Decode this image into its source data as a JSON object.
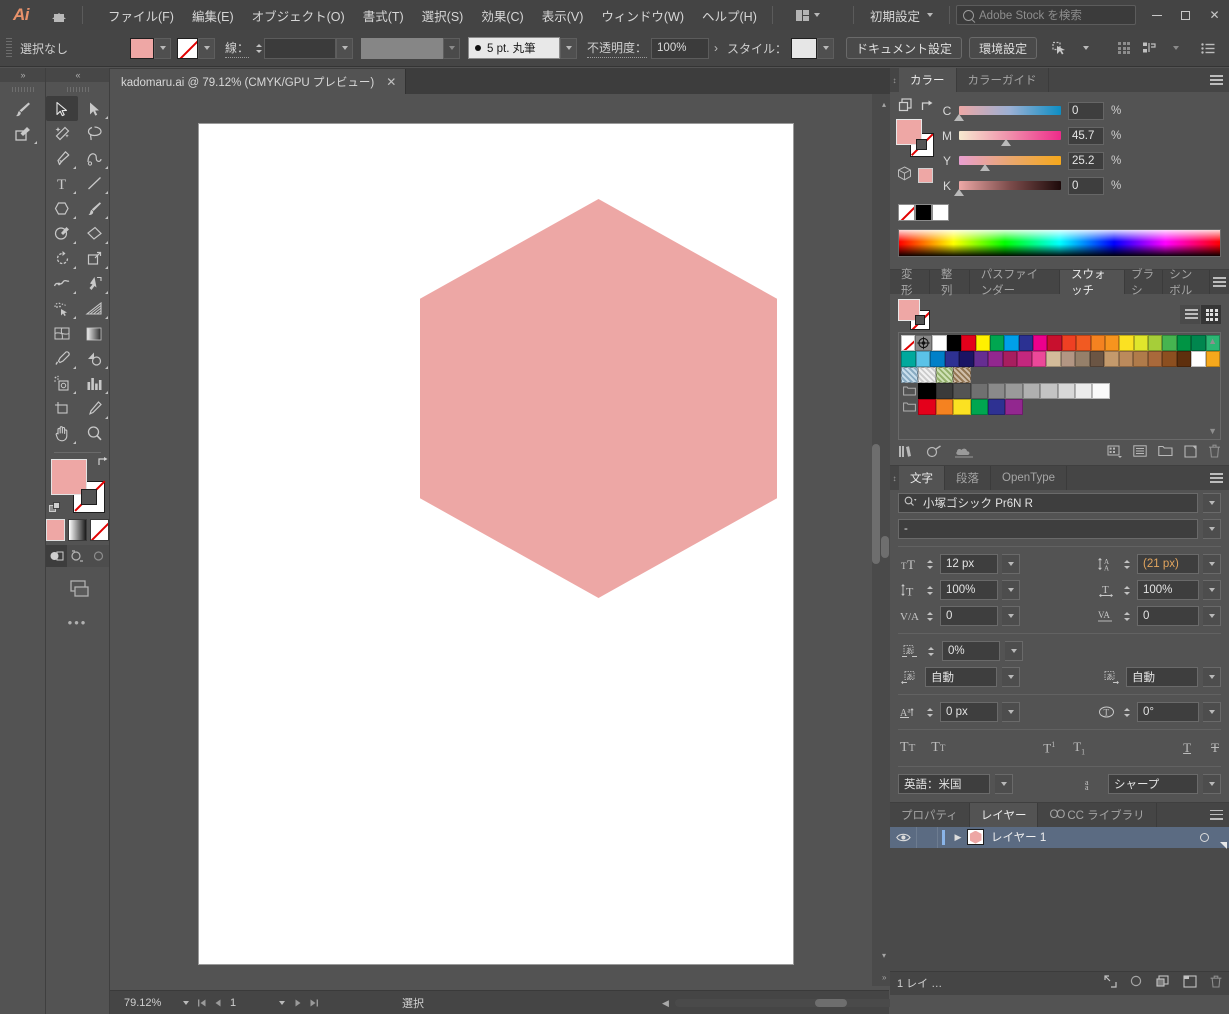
{
  "app": {
    "logo": "Ai",
    "home_icon": "home-icon"
  },
  "menubar": {
    "items": [
      {
        "label": "ファイル(F)"
      },
      {
        "label": "編集(E)"
      },
      {
        "label": "オブジェクト(O)"
      },
      {
        "label": "書式(T)"
      },
      {
        "label": "選択(S)"
      },
      {
        "label": "効果(C)"
      },
      {
        "label": "表示(V)"
      },
      {
        "label": "ウィンドウ(W)"
      },
      {
        "label": "ヘルプ(H)"
      }
    ],
    "arrange_icon": "arrange-documents-icon",
    "workspace": "初期設定",
    "search_placeholder": "Adobe Stock を検索",
    "window_controls": {
      "minimize": "minimize-icon",
      "maximize": "maximize-icon",
      "close": "✕"
    }
  },
  "controlbar": {
    "selection_status": "選択なし",
    "fill_color": "#eea7a5",
    "stroke_color": "none",
    "stroke_label": "線：",
    "stroke_weight": "",
    "stroke_profile": "",
    "brush_definition": "5 pt. 丸筆",
    "opacity_label": "不透明度：",
    "opacity_value": "100%",
    "style_label": "スタイル：",
    "document_setup": "ドキュメント設定",
    "preferences": "環境設定",
    "select_similar_icon": "select-similar-icon",
    "align_icon": "align-icon",
    "distribute_icon": "distribute-icon",
    "more_options_icon": "panel-options-icon"
  },
  "tabbar": {
    "document_tab": "kadomaru.ai @ 79.12% (CMYK/GPU プレビュー)",
    "close_icon": "✕"
  },
  "toolbar": {
    "left_column": [
      "paintbrush-tool-icon",
      "shaper-tool-icon"
    ],
    "tools": [
      {
        "name": "selection-tool",
        "selected": true
      },
      {
        "name": "direct-selection-tool",
        "selected": false
      },
      {
        "name": "magic-wand-tool",
        "selected": false
      },
      {
        "name": "lasso-tool",
        "selected": false
      },
      {
        "name": "pen-tool",
        "selected": false
      },
      {
        "name": "curvature-tool",
        "selected": false
      },
      {
        "name": "type-tool",
        "selected": false
      },
      {
        "name": "line-segment-tool",
        "selected": false
      },
      {
        "name": "polygon-shape-tool",
        "selected": false
      },
      {
        "name": "paintbrush-tool",
        "selected": false
      },
      {
        "name": "shaper-tool",
        "selected": false
      },
      {
        "name": "eraser-tool",
        "selected": false
      },
      {
        "name": "rotate-tool",
        "selected": false
      },
      {
        "name": "scale-tool",
        "selected": false
      },
      {
        "name": "width-tool",
        "selected": false
      },
      {
        "name": "free-transform-tool",
        "selected": false
      },
      {
        "name": "shape-builder-tool",
        "selected": false
      },
      {
        "name": "perspective-grid-tool",
        "selected": false
      },
      {
        "name": "mesh-tool",
        "selected": false
      },
      {
        "name": "gradient-tool",
        "selected": false
      },
      {
        "name": "eyedropper-tool",
        "selected": false
      },
      {
        "name": "blend-tool",
        "selected": false
      },
      {
        "name": "symbol-sprayer-tool",
        "selected": false
      },
      {
        "name": "column-graph-tool",
        "selected": false
      },
      {
        "name": "artboard-tool",
        "selected": false
      },
      {
        "name": "slice-tool",
        "selected": false
      },
      {
        "name": "hand-tool",
        "selected": false
      },
      {
        "name": "zoom-tool",
        "selected": false
      }
    ],
    "fill_color": "#eea7a5",
    "stroke_color": "none",
    "color_modes": [
      "color-swatch-mode",
      "gradient-mode",
      "none-mode"
    ],
    "draw_modes": [
      "draw-normal",
      "draw-behind",
      "draw-inside"
    ],
    "screen_mode_icon": "screen-mode-icon",
    "edit_toolbar": "•••"
  },
  "canvas": {
    "artboard_background": "#ffffff",
    "shape": {
      "name": "hexagon",
      "fill": "#eda7a5"
    }
  },
  "statusbar": {
    "zoom": "79.12%",
    "page": "1",
    "status_text": "選択",
    "first_icon": "first-page-icon",
    "prev_icon": "previous-page-icon",
    "next_icon": "next-page-icon",
    "last_icon": "last-page-icon"
  },
  "color_panel": {
    "tabs": [
      {
        "label": "カラー",
        "active": true
      },
      {
        "label": "カラーガイド",
        "active": false
      }
    ],
    "mode": "CMYK",
    "channels": [
      {
        "label": "C",
        "value": "0",
        "pct": "%",
        "pos": 0
      },
      {
        "label": "M",
        "value": "45.7",
        "pct": "%",
        "pos": 46
      },
      {
        "label": "Y",
        "value": "25.2",
        "pct": "%",
        "pos": 25
      },
      {
        "label": "K",
        "value": "0",
        "pct": "%",
        "pos": 0
      }
    ],
    "fill_color": "#eea7a5",
    "quick_swatches": [
      "none",
      "#000000",
      "#ffffff"
    ]
  },
  "swatches_panel": {
    "tabs": [
      {
        "label": "変形",
        "active": false
      },
      {
        "label": "整列",
        "active": false
      },
      {
        "label": "パスファインダー",
        "active": false
      },
      {
        "label": "スウォッチ",
        "active": true
      },
      {
        "label": "ブラシ",
        "active": false
      },
      {
        "label": "シンボル",
        "active": false
      }
    ],
    "view_list_icon": "list-view-icon",
    "view_grid_icon": "grid-view-icon",
    "rows": [
      [
        "none",
        "registration",
        "#ffffff",
        "#000000",
        "#e4001b",
        "#fff000",
        "#00a650",
        "#00a0e9",
        "#2b3192",
        "#ec008c",
        "#c8102e",
        "#ef4023",
        "#f15a22",
        "#f58220",
        "#f7941e",
        "#fbe122",
        "#e0e62c",
        "#a6ce39",
        "#46b450",
        "#009444",
        "#00864e",
        "#2bb673"
      ],
      [
        "#00a99d",
        "#5bc2e7",
        "#0080c8",
        "#2e3192",
        "#1b1464",
        "#662d91",
        "#92278f",
        "#a81e5f",
        "#c4277e",
        "#ec4899",
        "#d3bc9a",
        "#b29683",
        "#95806a",
        "#6b5544",
        "#c49a6c",
        "#bb8a5c",
        "#b07b4a",
        "#a9693b",
        "#8c4f20",
        "#5e2f0d",
        "#ffffff",
        "#f6a81c"
      ],
      [
        "pattern-blue",
        "pattern-circle",
        "pattern-green",
        "pattern-brown"
      ],
      [
        "folder",
        "#000000",
        "#3a3a3a",
        "#545454",
        "#707070",
        "#8a8a8a",
        "#9a9a9a",
        "#b0b0b0",
        "#c4c4c4",
        "#d8d8d8",
        "#ececec",
        "#fafafa"
      ],
      [
        "folder",
        "#e4001b",
        "#f58220",
        "#fbe122",
        "#00a650",
        "#2e3192",
        "#92278f"
      ]
    ],
    "footer_icons": [
      "swatch-libraries-icon",
      "color-theme-icon",
      "library-cloud-icon",
      "show-kind-icon",
      "swatch-options-icon",
      "new-group-icon",
      "new-swatch-icon",
      "delete-swatch-icon"
    ]
  },
  "character_panel": {
    "tabs": [
      {
        "label": "文字",
        "active": true
      },
      {
        "label": "段落",
        "active": false
      },
      {
        "label": "OpenType",
        "active": false
      }
    ],
    "font_family": "小塚ゴシック Pr6N R",
    "font_style": "-",
    "font_size": "12 px",
    "leading": "(21 px)",
    "vertical_scale": "100%",
    "horizontal_scale": "100%",
    "tracking": "0",
    "kerning": "0",
    "tsume": "0%",
    "left_aki": "自動",
    "right_aki": "自動",
    "baseline_shift": "0 px",
    "rotation": "0°",
    "style_buttons": [
      "all-caps-icon",
      "small-caps-icon",
      "superscript-icon",
      "subscript-icon",
      "underline-icon",
      "strikethrough-icon"
    ],
    "language": "英語：米国",
    "antialias": "シャープ"
  },
  "layers_panel": {
    "tabs": [
      {
        "label": "プロパティ",
        "active": false
      },
      {
        "label": "レイヤー",
        "active": true
      },
      {
        "label": "CC ライブラリ",
        "active": false
      }
    ],
    "layers": [
      {
        "name": "レイヤー 1",
        "visible": true,
        "locked": false,
        "color": "#eda7a5",
        "selected": true
      }
    ],
    "footer_count": "1 レイ …",
    "footer_icons": [
      "locate-object-icon",
      "make-clipping-mask-icon",
      "create-new-sublayer-icon",
      "create-new-layer-icon",
      "delete-selection-icon"
    ]
  }
}
